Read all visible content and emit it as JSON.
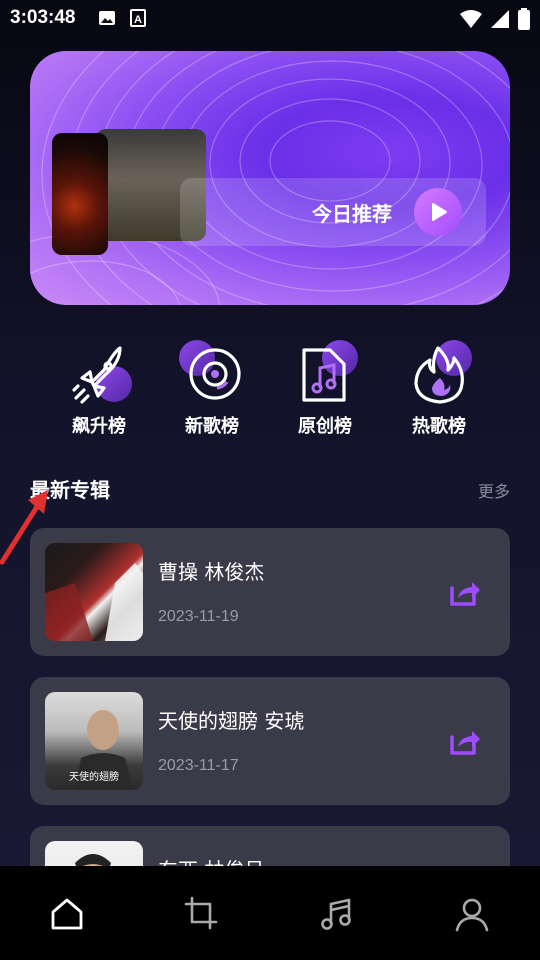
{
  "status_bar": {
    "time": "3:03:48",
    "left_icons": [
      "image-icon",
      "text-a-icon"
    ],
    "right_icons": [
      "wifi-icon",
      "signal-icon",
      "battery-icon"
    ]
  },
  "banner": {
    "today_label": "今日推荐"
  },
  "rankings": [
    {
      "label": "飙升榜",
      "icon": "rocket-icon"
    },
    {
      "label": "新歌榜",
      "icon": "disc-icon"
    },
    {
      "label": "原创榜",
      "icon": "music-file-icon"
    },
    {
      "label": "热歌榜",
      "icon": "fire-icon"
    }
  ],
  "section": {
    "title": "最新专辑",
    "more": "更多"
  },
  "albums": [
    {
      "title": "曹操 林俊杰",
      "date": "2023-11-19"
    },
    {
      "title": "天使的翅膀 安琥",
      "date": "2023-11-17",
      "cover_text": "天使的翅膀"
    },
    {
      "title": "东西 林俊呈",
      "date": ""
    }
  ],
  "bottom_nav": [
    "home-icon",
    "crop-icon",
    "music-icon",
    "profile-icon"
  ],
  "colors": {
    "accent": "#9b4dff",
    "card": "#3a3a48",
    "banner_start": "#7d3cf0"
  }
}
